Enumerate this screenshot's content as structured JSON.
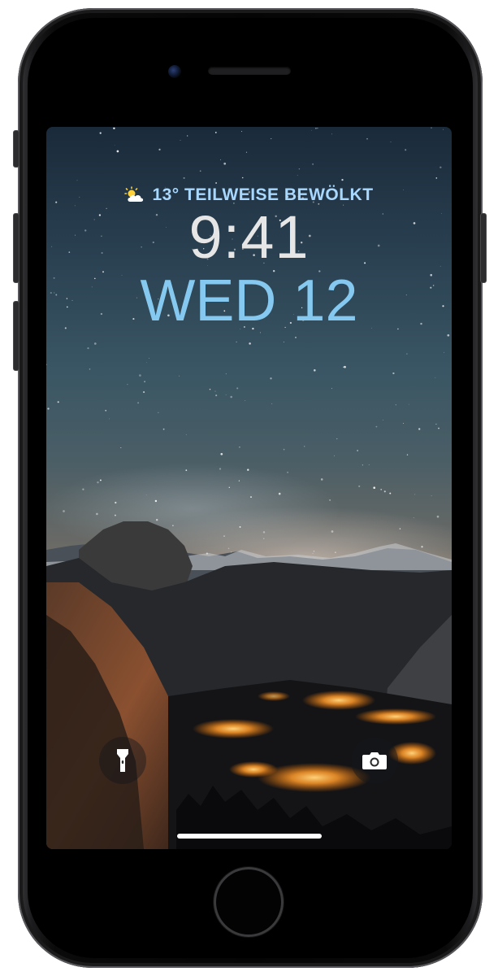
{
  "lock_screen": {
    "weather": {
      "icon": "partly-cloudy-sun-icon",
      "text": "13° TEILWEISE BEWÖLKT"
    },
    "time": "9:41",
    "date": "WED 12",
    "quick_actions": {
      "left": "flashlight-icon",
      "right": "camera-icon"
    }
  },
  "colors": {
    "weather_text": "#a9d8ff",
    "time_text": "#e6e6e6",
    "date_text": "#86c9f0",
    "frame": "#1c1c1e"
  }
}
